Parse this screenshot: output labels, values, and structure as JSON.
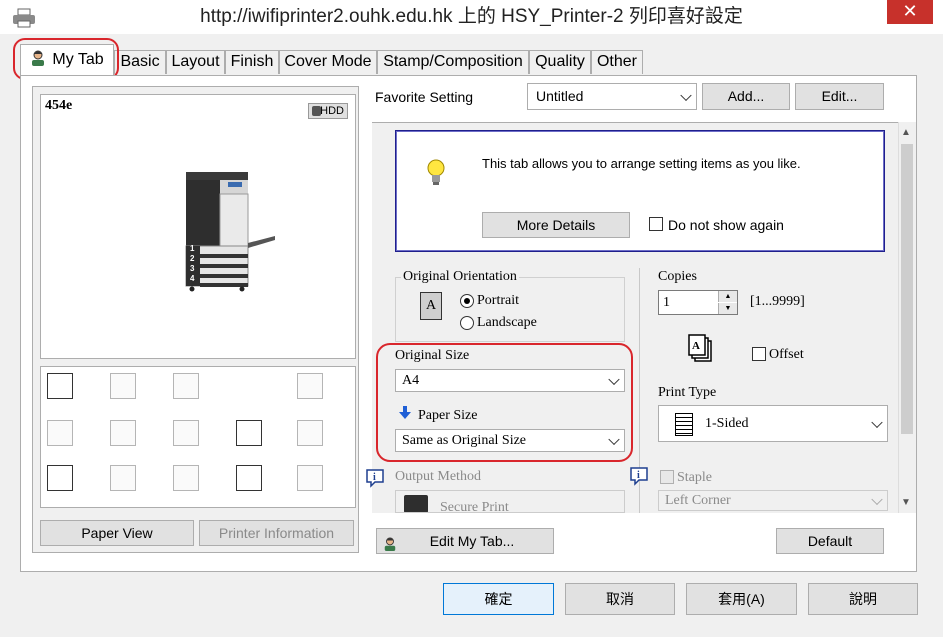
{
  "window": {
    "title": "http://iwifiprinter2.ouhk.edu.hk 上的 HSY_Printer-2 列印喜好設定",
    "close": "✕"
  },
  "tabs": [
    "My Tab",
    "Basic",
    "Layout",
    "Finish",
    "Cover Mode",
    "Stamp/Composition",
    "Quality",
    "Other"
  ],
  "preview": {
    "model": "454e",
    "hdd_badge": "HDD",
    "tray_numbers": [
      "1",
      "2",
      "3",
      "4"
    ]
  },
  "left_buttons": {
    "paper_view": "Paper View",
    "printer_info": "Printer Information"
  },
  "favorite": {
    "label": "Favorite Setting",
    "value": "Untitled",
    "add": "Add...",
    "edit": "Edit..."
  },
  "info_box": {
    "message": "This tab allows you to arrange setting items as you like.",
    "more_details": "More Details",
    "do_not_show": "Do not show again"
  },
  "orientation": {
    "label": "Original Orientation",
    "icon_letter": "A",
    "portrait": "Portrait",
    "landscape": "Landscape"
  },
  "original_size": {
    "label": "Original Size",
    "value": "A4"
  },
  "paper_size": {
    "label": "Paper Size",
    "value": "Same as Original Size"
  },
  "copies": {
    "label": "Copies",
    "value": "1",
    "range": "[1...9999]",
    "offset": "Offset"
  },
  "print_type": {
    "label": "Print Type",
    "value": "1-Sided"
  },
  "output_method": {
    "label": "Output Method",
    "value": "Secure Print"
  },
  "staple": {
    "label": "Staple",
    "value": "Left Corner"
  },
  "edit_my_tab": "Edit My Tab...",
  "default_btn": "Default",
  "footer": {
    "ok": "確定",
    "cancel": "取消",
    "apply": "套用(A)",
    "help": "說明"
  },
  "icons": [
    "printer-icon",
    "user-icon",
    "lightbulb-icon",
    "hdd-icon",
    "down-arrow-icon",
    "info-icon",
    "secure-print-icon",
    "print-type-icon"
  ]
}
